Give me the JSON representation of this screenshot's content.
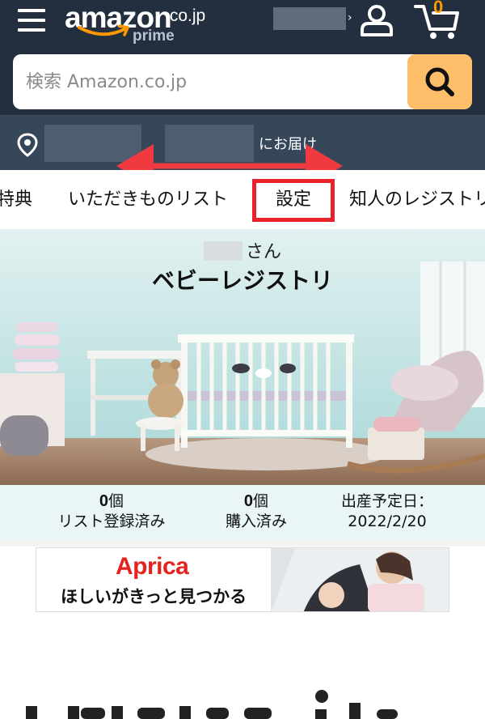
{
  "header": {
    "logo_word": "amazon",
    "logo_tld": ".co.jp",
    "logo_sub": "prime",
    "cart_count": "0"
  },
  "search": {
    "placeholder": "検索 Amazon.co.jp"
  },
  "deliver": {
    "suffix": "にお届け"
  },
  "tabs": [
    {
      "label": "特典"
    },
    {
      "label": "いただきものリスト"
    },
    {
      "label": "設定"
    },
    {
      "label": "知人のレジストリ"
    }
  ],
  "hero": {
    "greeting_suffix": "さん",
    "title": "ベビーレジストリ"
  },
  "stats": [
    {
      "value": "0",
      "unit": "個",
      "label": "リスト登録済み"
    },
    {
      "value": "0",
      "unit": "個",
      "label": "購入済み"
    },
    {
      "label": "出産予定日：",
      "value": "2022/2/20"
    }
  ],
  "ad": {
    "brand": "Aprica",
    "copy": "ほしいがきっと見つかる"
  },
  "colors": {
    "header_bg": "#232f3e",
    "deliver_bg": "#37475a",
    "search_button": "#febd69",
    "accent_orange": "#ff9900",
    "annotation_red": "#e8222a",
    "stats_bg": "#e9f5f6"
  },
  "icons": [
    "menu-icon",
    "user-icon",
    "cart-icon",
    "search-icon",
    "location-pin-icon"
  ]
}
